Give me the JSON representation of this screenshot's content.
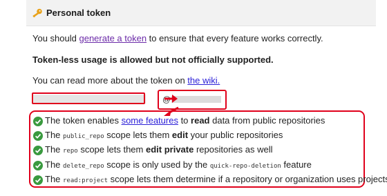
{
  "header": {
    "title": "Personal token",
    "icon": "key-icon"
  },
  "intro": {
    "prefix": "You should ",
    "link": "generate a token",
    "suffix": " to ensure that every feature works correctly."
  },
  "notice": "Token-less usage is allowed but not officially supported.",
  "wiki": {
    "prefix": "You can read more about the token on ",
    "link": "the wiki."
  },
  "inputs": {
    "user_prefix": "@"
  },
  "annotation_color": "#e0001b",
  "check_color": "#3a9a3f",
  "scopes": [
    {
      "a": "The token enables ",
      "link": "some features",
      "b": " to ",
      "bold": "read",
      "c": " data from public repositories"
    },
    {
      "a": "The ",
      "code": "public_repo",
      "b": " scope lets them ",
      "bold": "edit",
      "c": " your public repositories"
    },
    {
      "a": "The ",
      "code": "repo",
      "b": " scope lets them ",
      "bold": "edit private",
      "c": " repositories as well"
    },
    {
      "a": "The ",
      "code": "delete_repo",
      "b": " scope is only used by the ",
      "code2": "quick-repo-deletion",
      "c": " feature"
    },
    {
      "a": "The ",
      "code": "read:project",
      "b": " scope lets them determine if a repository or organization uses projects"
    }
  ]
}
